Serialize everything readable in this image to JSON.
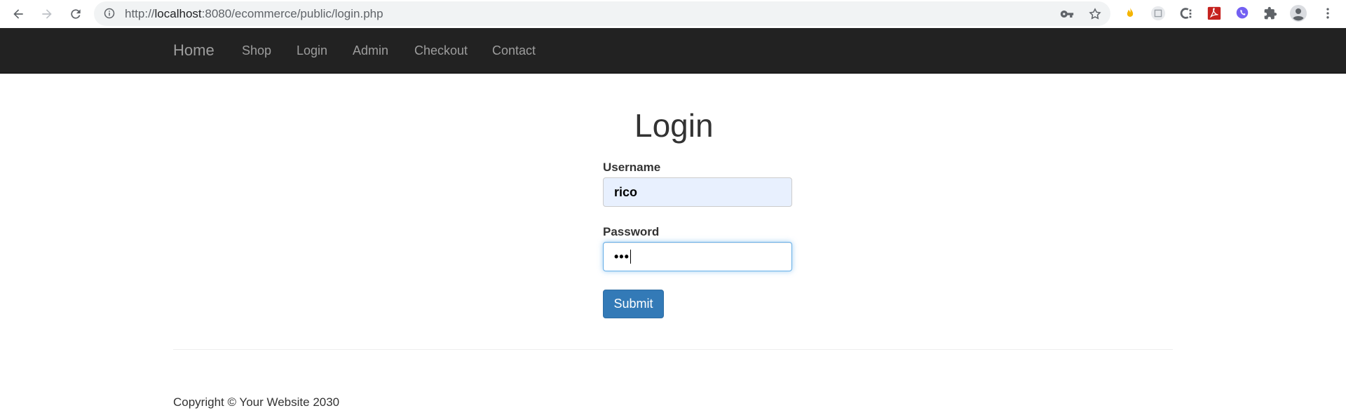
{
  "browser": {
    "url_prefix": "http://",
    "url_host": "localhost",
    "url_rest": ":8080/ecommerce/public/login.php"
  },
  "navbar": {
    "brand": "Home",
    "links": [
      "Shop",
      "Login",
      "Admin",
      "Checkout",
      "Contact"
    ]
  },
  "main": {
    "title": "Login",
    "username_label": "Username",
    "username_value": "rico",
    "password_label": "Password",
    "password_value": "•••",
    "submit_label": "Submit"
  },
  "footer": {
    "copyright": "Copyright © Your Website 2030"
  },
  "colors": {
    "navbar_bg": "#222222",
    "primary": "#337ab7",
    "autofill_bg": "#e8f0fe"
  }
}
